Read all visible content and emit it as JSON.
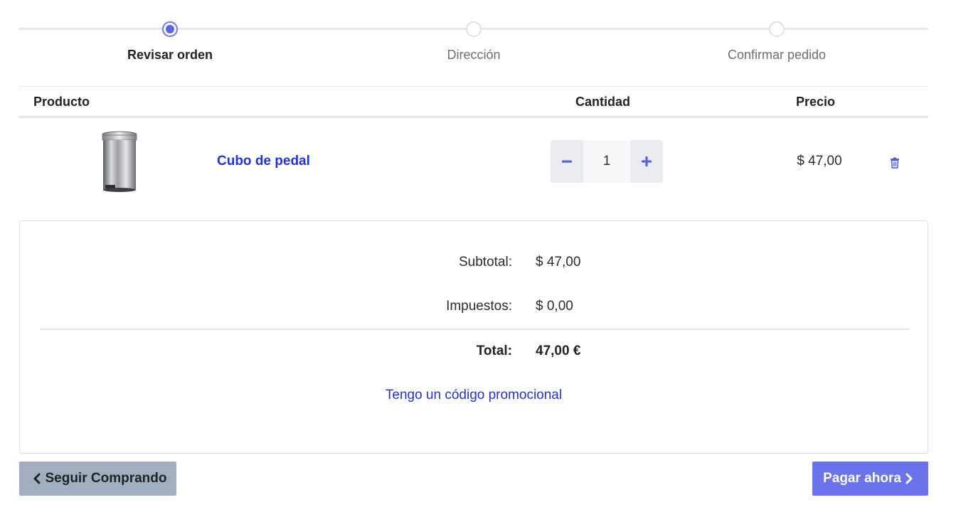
{
  "steps": [
    {
      "label": "Revisar orden",
      "active": true
    },
    {
      "label": "Dirección",
      "active": false
    },
    {
      "label": "Confirmar pedido",
      "active": false
    }
  ],
  "table": {
    "headers": {
      "product": "Producto",
      "quantity": "Cantidad",
      "price": "Precio"
    },
    "items": [
      {
        "name": "Cubo de pedal",
        "quantity": "1",
        "price": "$ 47,00",
        "image_icon": "pedal-bin-image"
      }
    ]
  },
  "summary": {
    "subtotal_label": "Subtotal:",
    "subtotal_value": "$ 47,00",
    "tax_label": "Impuestos:",
    "tax_value": "$ 0,00",
    "total_label": "Total:",
    "total_value": "47,00 €",
    "promo_link": "Tengo un código promocional"
  },
  "actions": {
    "back_label": "Seguir Comprando",
    "pay_label": "Pagar ahora"
  },
  "colors": {
    "accent": "#5865e0",
    "link": "#2233d6",
    "pay_button": "#6b73ec",
    "back_button": "#a0aebf"
  }
}
